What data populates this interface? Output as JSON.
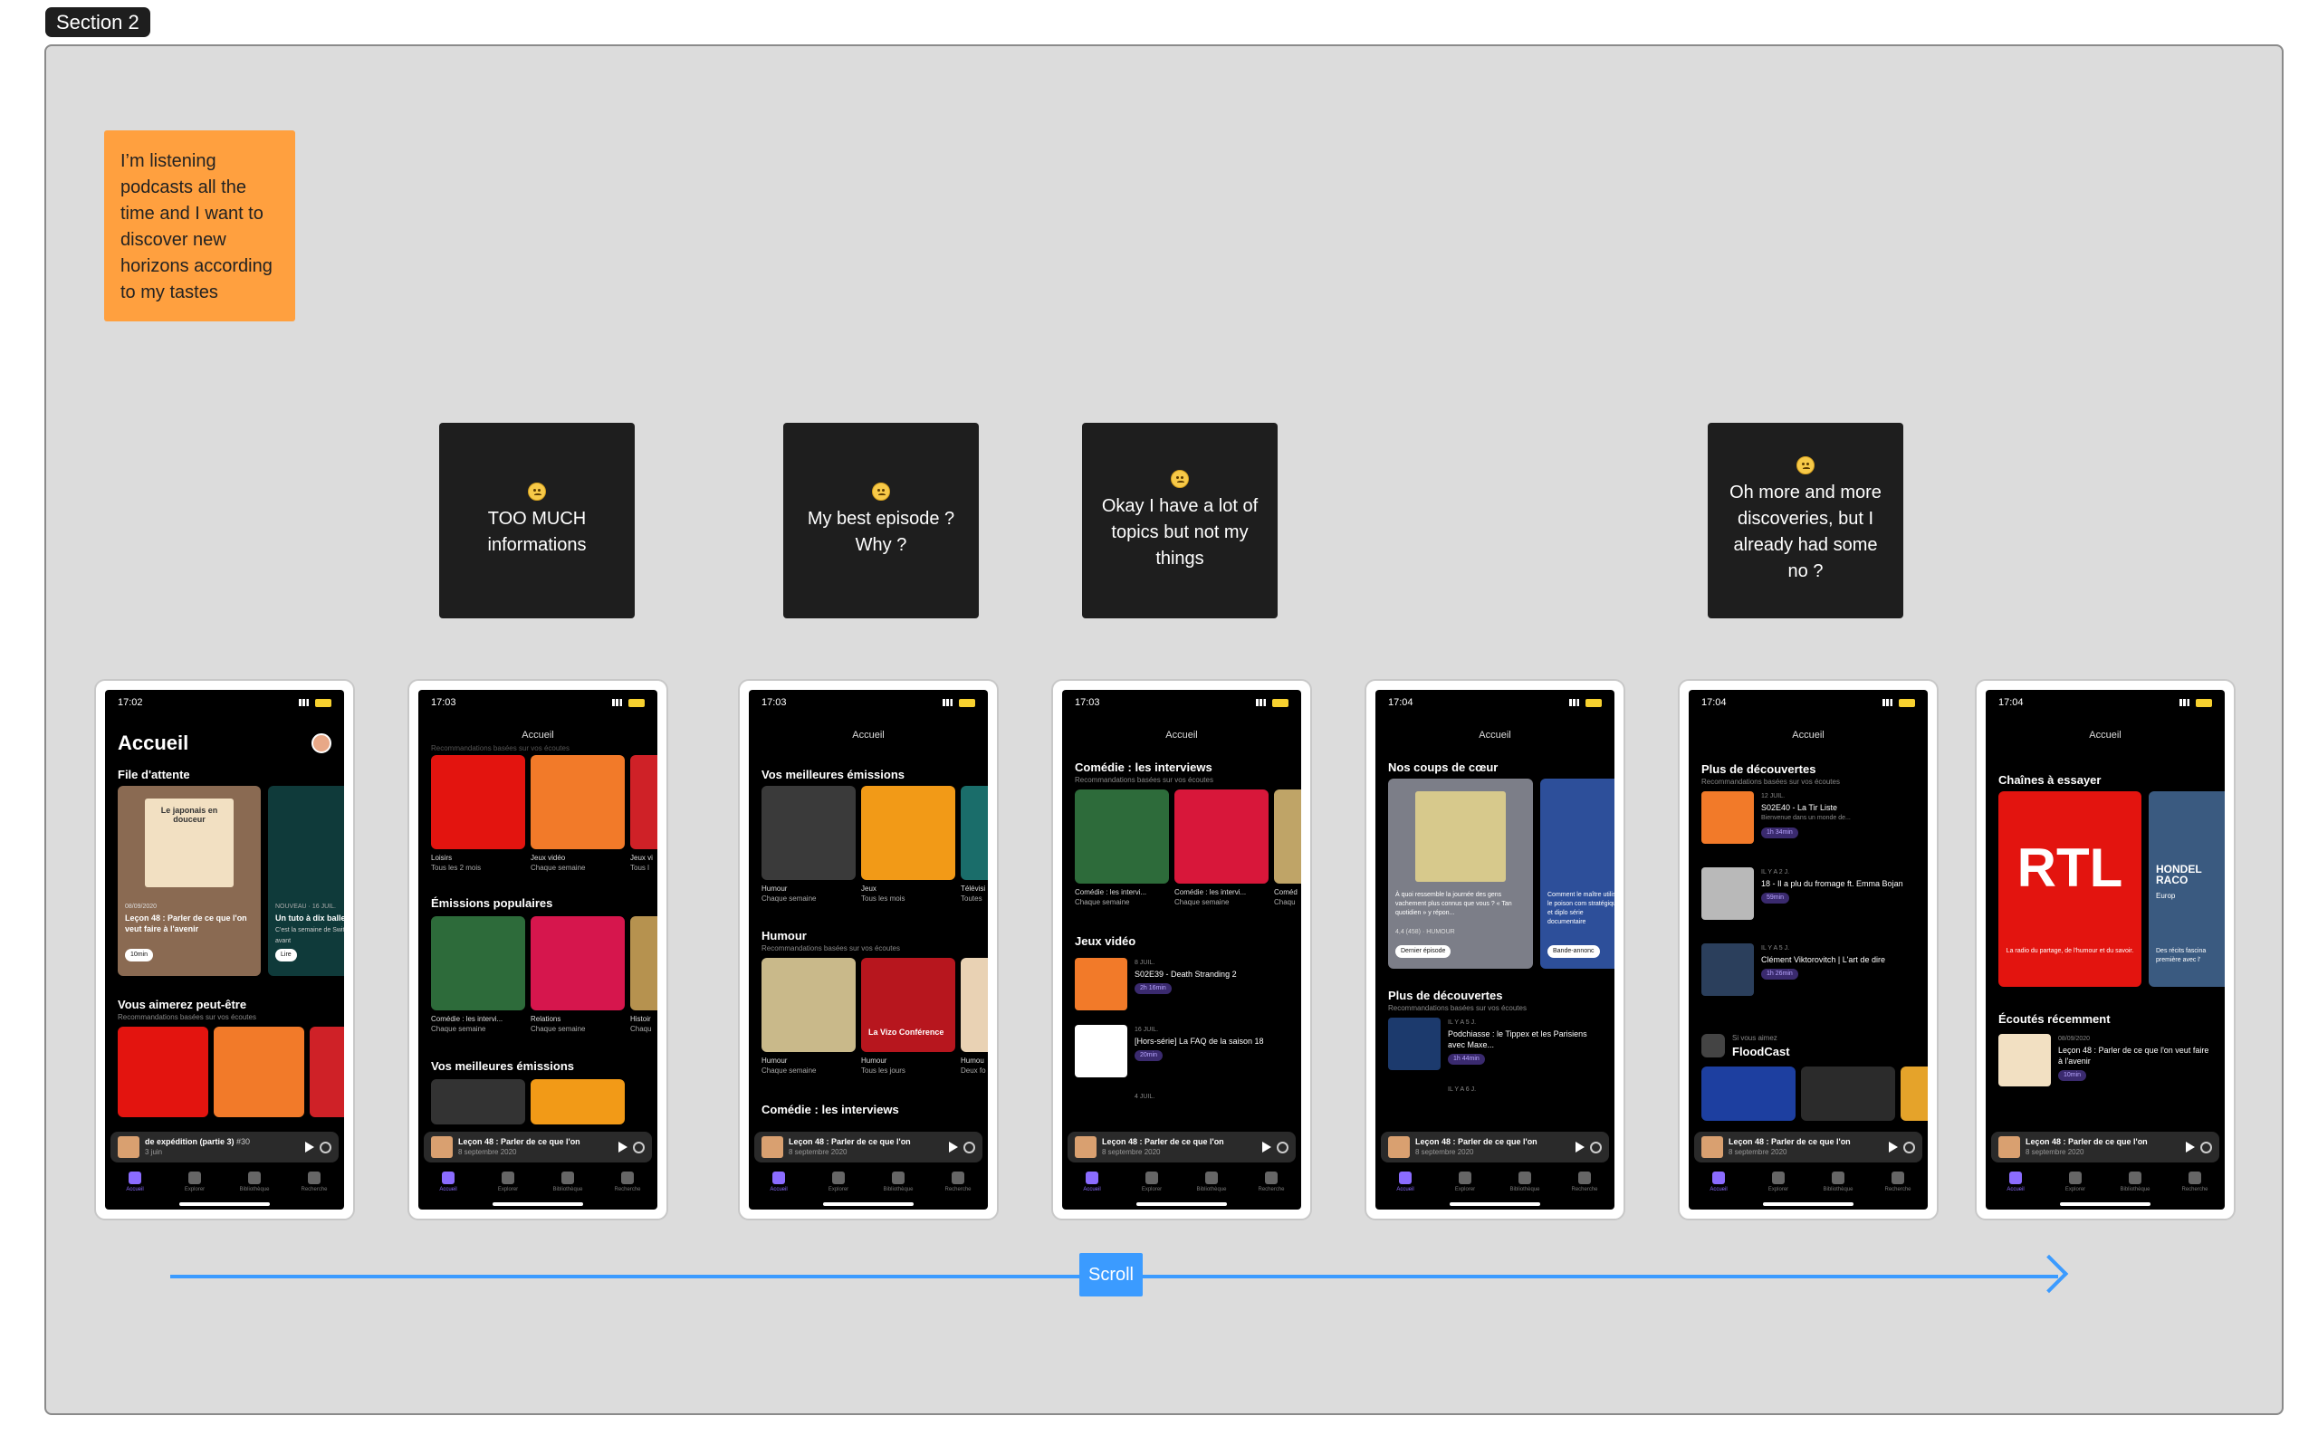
{
  "section_label": "Section 2",
  "persona_note": "I’m listening podcasts all the time and I want to discover new horizons according to my tastes",
  "pain_points": [
    "TOO MUCH informations",
    "My best episode ? Why ?",
    "Okay I have a lot of topics but not my things",
    "Oh more and more discoveries, but I already had some no ?"
  ],
  "scroll_label": "Scroll",
  "tabs": [
    "Accueil",
    "Explorer",
    "Bibliothèque",
    "Recherche"
  ],
  "miniplayer": {
    "title": "Leçon 48 : Parler de ce que l'on",
    "sub": "8 septembre 2020"
  },
  "screens": [
    {
      "time": "17:02",
      "title": "Accueil",
      "s1": "File d'attente",
      "card1_title": "Le japonais en douceur",
      "card1_date": "08/09/2020",
      "card1_text": "Leçon 48 : Parler de ce que l'on veut faire à l'avenir",
      "card1_dur": "10min",
      "card2_date": "NOUVEAU · 16 JUIL.",
      "card2_text": "Un tuto à dix balles",
      "card2_sub": "C'est la semaine de Switch 2. En avant",
      "card2_btn": "Lire",
      "s2": "Vous aimerez peut-être",
      "s2_sub": "Recommandations basées sur vos écoutes",
      "mini_title": "de expédition (partie 3)",
      "mini_ep": "#30",
      "mini_sub": "3 juin"
    },
    {
      "time": "17:03",
      "nav": "Accueil",
      "sub0": "Recommandations basées sur vos écoutes",
      "t1": "Loisirs",
      "t1s": "Tous les 2 mois",
      "t2": "Jeux vidéo",
      "t2s": "Chaque semaine",
      "t3": "Jeux vi",
      "t3s": "Tous l",
      "s2": "Émissions populaires",
      "t4": "Comédie : les intervi...",
      "t4s": "Chaque semaine",
      "t5": "Relations",
      "t5s": "Chaque semaine",
      "t6": "Histoir",
      "t6s": "Chaqu",
      "s3": "Vos meilleures émissions"
    },
    {
      "time": "17:03",
      "nav": "Accueil",
      "s1": "Vos meilleures émissions",
      "t1": "Humour",
      "t1s": "Chaque semaine",
      "t2": "Jeux",
      "t2s": "Tous les mois",
      "t3": "Télévisi",
      "t3s": "Toutes",
      "s2": "Humour",
      "s2_sub": "Recommandations basées sur vos écoutes",
      "t4": "Humour",
      "t4s": "Chaque semaine",
      "t5": "Humour",
      "t5s": "Tous les jours",
      "t5_label": "La Vizo Conférence",
      "t6": "Humou",
      "t6s": "Deux fo",
      "s3": "Comédie : les interviews"
    },
    {
      "time": "17:03",
      "nav": "Accueil",
      "s1": "Comédie : les interviews",
      "s1_sub": "Recommandations basées sur vos écoutes",
      "t1": "Comédie : les intervi...",
      "t1s": "Chaque semaine",
      "t2": "Comédie : les intervi...",
      "t2s": "Chaque semaine",
      "t3": "Coméd",
      "t3s": "Chaqu",
      "s2": "Jeux vidéo",
      "e1_meta": "8 JUIL.",
      "e1_title": "S02E39 - Death Stranding 2",
      "e1_dur": "2h 16min",
      "e2_meta": "16 JUIL.",
      "e2_title": "[Hors-série] La FAQ de la saison 18",
      "e2_dur": "20min",
      "e3_meta": "4 JUIL."
    },
    {
      "time": "17:04",
      "nav": "Accueil",
      "s1": "Nos coups de cœur",
      "c1_text": "À quoi ressemble la journée des gens vachement plus connus que vous ? « Tan quotidien » y répon...",
      "c1_rating": "4,4 (458) · HUMOUR",
      "c1_btn": "Dernier épisode",
      "c2_text": "Comment le maître utilisé le poison com stratégique et diplo série documentaire",
      "c2_btn": "Bande-annonc",
      "s2": "Plus de découvertes",
      "s2_sub": "Recommandations basées sur vos écoutes",
      "e1_meta": "IL Y A 5 J.",
      "e1_title": "Podchiasse : le Tippex et les Parisiens avec Maxe...",
      "e1_dur": "1h 44min",
      "e2_meta": "IL Y A 6 J."
    },
    {
      "time": "17:04",
      "nav": "Accueil",
      "s1": "Plus de découvertes",
      "s1_sub": "Recommandations basées sur vos écoutes",
      "e1_meta": "12 JUIL.",
      "e1_title": "S02E40 - La Tir Liste",
      "e1_sub": "Bienvenue dans un monde de...",
      "e1_dur": "1h 34min",
      "e2_meta": "IL Y A 2 J.",
      "e2_title": "18 - Il a plu du fromage ft. Emma Bojan",
      "e2_dur": "59min",
      "e3_meta": "IL Y A 5 J.",
      "e3_title": "Clément Viktorovitch | L'art de dire",
      "e3_dur": "1h 26min",
      "s2_sub": "Si vous aimez",
      "s2": "FloodCast"
    },
    {
      "time": "17:04",
      "nav": "Accueil",
      "s1": "Chaînes à essayer",
      "c1_brand": "RTL",
      "c1_text": "La radio du partage, de l'humour et du savoir.",
      "c2_brand": "HONDEL RACO",
      "c2_sub": "Europ",
      "c2_text": "Des récits fascina première avec l'",
      "s2": "Écoutés récemment",
      "e1_meta": "08/09/2020",
      "e1_title": "Leçon 48 : Parler de ce que l'on veut faire à l'avenir",
      "e1_dur": "10min"
    }
  ]
}
